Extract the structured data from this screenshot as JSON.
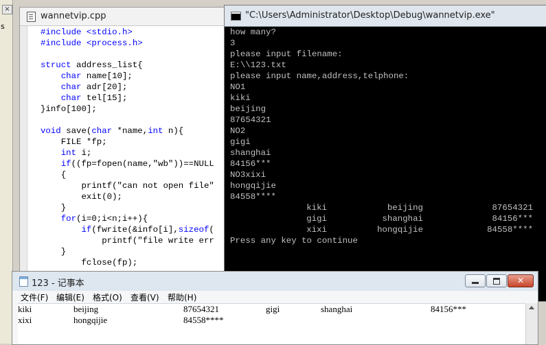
{
  "left_panel": {
    "close_glyph": "×",
    "letter": "s"
  },
  "editor": {
    "title": "wannetvip.cpp",
    "lines": [
      [
        {
          "t": "#include <stdio.h>",
          "k": 1
        }
      ],
      [
        {
          "t": "#include <process.h>",
          "k": 1
        }
      ],
      [
        {
          "t": "",
          "k": 0
        }
      ],
      [
        {
          "t": "struct",
          "k": 1
        },
        {
          "t": " address_list{",
          "k": 0
        }
      ],
      [
        {
          "t": "    ",
          "k": 0
        },
        {
          "t": "char",
          "k": 1
        },
        {
          "t": " name[10];",
          "k": 0
        }
      ],
      [
        {
          "t": "    ",
          "k": 0
        },
        {
          "t": "char",
          "k": 1
        },
        {
          "t": " adr[20];",
          "k": 0
        }
      ],
      [
        {
          "t": "    ",
          "k": 0
        },
        {
          "t": "char",
          "k": 1
        },
        {
          "t": " tel[15];",
          "k": 0
        }
      ],
      [
        {
          "t": "}info[100];",
          "k": 0
        }
      ],
      [
        {
          "t": "",
          "k": 0
        }
      ],
      [
        {
          "t": "void",
          "k": 1
        },
        {
          "t": " save(",
          "k": 0
        },
        {
          "t": "char",
          "k": 1
        },
        {
          "t": " *name,",
          "k": 0
        },
        {
          "t": "int",
          "k": 1
        },
        {
          "t": " n){",
          "k": 0
        }
      ],
      [
        {
          "t": "    FILE *fp;",
          "k": 0
        }
      ],
      [
        {
          "t": "    ",
          "k": 0
        },
        {
          "t": "int",
          "k": 1
        },
        {
          "t": " i;",
          "k": 0
        }
      ],
      [
        {
          "t": "    ",
          "k": 0
        },
        {
          "t": "if",
          "k": 1
        },
        {
          "t": "((fp=fopen(name,\"wb\"))==NULL",
          "k": 0
        }
      ],
      [
        {
          "t": "    {",
          "k": 0
        }
      ],
      [
        {
          "t": "        printf(\"can not open file\"",
          "k": 0
        }
      ],
      [
        {
          "t": "        exit(0);",
          "k": 0
        }
      ],
      [
        {
          "t": "    }",
          "k": 0
        }
      ],
      [
        {
          "t": "    ",
          "k": 0
        },
        {
          "t": "for",
          "k": 1
        },
        {
          "t": "(i=0;i<n;i++){",
          "k": 0
        }
      ],
      [
        {
          "t": "        ",
          "k": 0
        },
        {
          "t": "if",
          "k": 1
        },
        {
          "t": "(fwrite(&info[i],",
          "k": 0
        },
        {
          "t": "sizeof",
          "k": 1
        },
        {
          "t": "(",
          "k": 0
        }
      ],
      [
        {
          "t": "            printf(\"file write err",
          "k": 0
        }
      ],
      [
        {
          "t": "    }",
          "k": 0
        }
      ],
      [
        {
          "t": "        fclose(fp);",
          "k": 0
        }
      ]
    ]
  },
  "console": {
    "title": "\"C:\\Users\\Administrator\\Desktop\\Debug\\wannetvip.exe\"",
    "lines_top": [
      "how many?",
      "3",
      "please input filename:",
      "E:\\\\123.txt",
      "please input name,address,telphone:",
      "NO1",
      "kiki",
      "beijing",
      "87654321",
      "NO2",
      "gigi",
      "shanghai",
      "84156***",
      "NO3xixi",
      "hongqijie",
      "84558****"
    ],
    "table_rows": [
      [
        "kiki",
        "beijing",
        "87654321"
      ],
      [
        "gigi",
        "shanghai",
        "84156***"
      ],
      [
        "xixi",
        "hongqijie",
        "84558****"
      ]
    ],
    "footer": "Press any key to continue"
  },
  "notepad": {
    "title": "123 - 记事本",
    "menu": [
      "文件(F)",
      "编辑(E)",
      "格式(O)",
      "查看(V)",
      "帮助(H)"
    ],
    "rows": [
      [
        "kiki",
        "beijing",
        "87654321",
        "gigi",
        "shanghai",
        "84156***"
      ],
      [
        "xixi",
        "hongqijie",
        "84558****"
      ]
    ]
  }
}
